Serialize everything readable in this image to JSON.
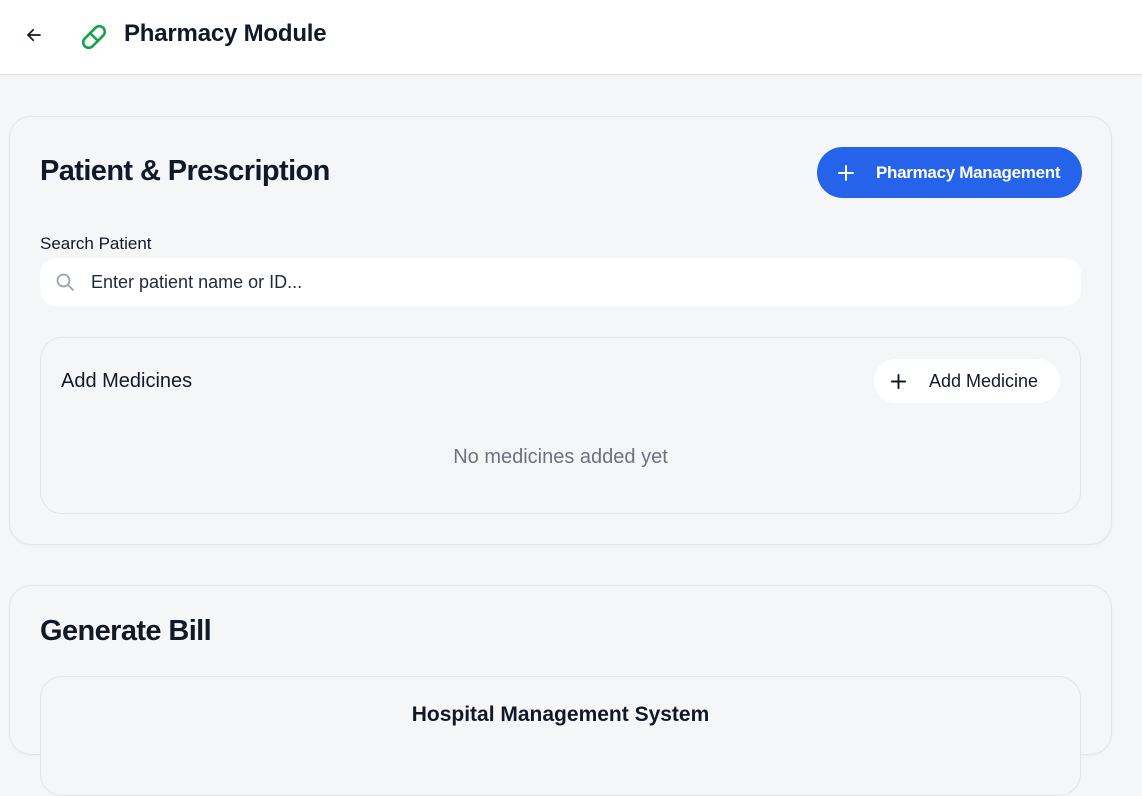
{
  "header": {
    "back_icon": "arrow-left-icon",
    "app_icon": "pill-icon",
    "title": "Pharmacy Module",
    "accent_color": "#16a34a"
  },
  "prescription": {
    "title": "Patient & Prescription",
    "pharmacy_button": {
      "icon": "plus-icon",
      "label": "Pharmacy Management",
      "color": "#2563eb"
    },
    "search": {
      "label": "Search Patient",
      "icon": "search-icon",
      "placeholder": "Enter patient name or ID...",
      "value": ""
    },
    "medicines": {
      "title": "Add Medicines",
      "add_button": {
        "icon": "plus-icon",
        "label": "Add Medicine"
      },
      "empty_text": "No medicines added yet"
    }
  },
  "bill": {
    "title": "Generate Bill",
    "hospital_name": "Hospital Management System"
  }
}
